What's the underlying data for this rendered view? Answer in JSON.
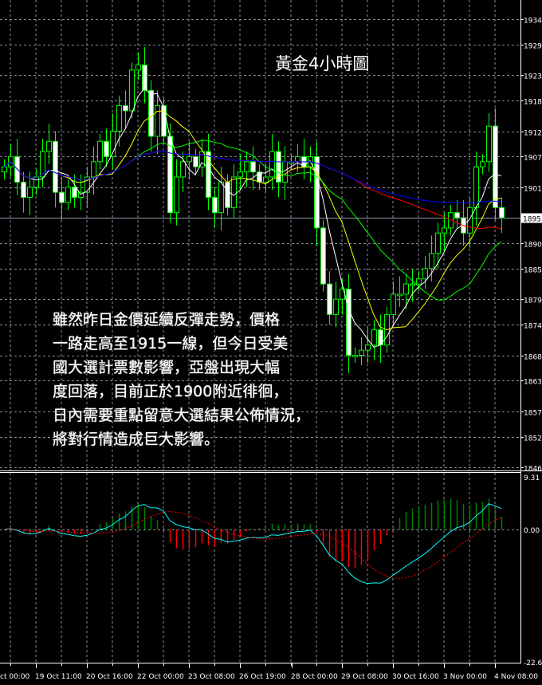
{
  "chart_data": {
    "type": "candlestick",
    "title": "黃金4小時圖",
    "price_axis": {
      "ticks": [
        1934,
        1929,
        1923,
        1918,
        1912,
        1907,
        1901,
        1895,
        1890,
        1885,
        1879,
        1874,
        1868,
        1863,
        1857,
        1852,
        1846
      ],
      "range": [
        1846,
        1934
      ],
      "current_price": 1895,
      "current_label": "1895"
    },
    "time_axis": {
      "ticks": [
        "ct 00:00",
        "19 Oct 11:00",
        "20 Oct 16:00",
        "22 Oct 00:00",
        "23 Oct 08:00",
        "26 Oct 19:00",
        "28 Oct 00:00",
        "29 Oct 08:00",
        "30 Oct 16:00",
        "3 Nov 00:00",
        "4 Nov 08:00"
      ]
    },
    "closes": [
      1905,
      1907,
      1902,
      1899,
      1901,
      1903,
      1908,
      1910,
      1900,
      1898,
      1901,
      1899,
      1900,
      1903,
      1906,
      1910,
      1907,
      1912,
      1917,
      1916,
      1924,
      1925,
      1920,
      1911,
      1917,
      1911,
      1896,
      1903,
      1906,
      1907,
      1905,
      1908,
      1899,
      1896,
      1902,
      1897,
      1903,
      1904,
      1906,
      1904,
      1902,
      1903,
      1908,
      1902,
      1906,
      1906,
      1907,
      1905,
      1907,
      1893,
      1882,
      1876,
      1879,
      1881,
      1868,
      1868,
      1869,
      1870,
      1873,
      1870,
      1876,
      1880,
      1880,
      1882,
      1882,
      1883,
      1885,
      1888,
      1892,
      1893,
      1896,
      1895,
      1892,
      1897,
      1905,
      1906,
      1913,
      1897,
      1895
    ],
    "moving_averages": [
      {
        "period": 5,
        "color": "#ffffff"
      },
      {
        "period": 10,
        "color": "#ffff00"
      },
      {
        "period": 20,
        "color": "#00ff00"
      },
      {
        "period": 50,
        "color": "#ff0000"
      },
      {
        "period": 100,
        "color": "#0000ff"
      }
    ],
    "macd": {
      "axis_labels": [
        "9.31",
        "0.00",
        "-22.6"
      ],
      "range": [
        -22.6,
        9.31
      ],
      "main_color": "#00ffff",
      "signal_color": "#ff0000",
      "hist_up": "#008000",
      "hist_down": "#ff0000"
    },
    "colors": {
      "bull_body": "#000000",
      "bear_body": "#ffffff",
      "outline": "#00ff00",
      "grid": "#8a8a9a"
    }
  },
  "annotation": {
    "lines": [
      "雖然昨日金價延續反彈走勢，價格",
      "一路走高至1915一線，但今日受美",
      "國大選計票數影響，亞盤出現大幅",
      "度回落，目前正於1900附近徘徊，",
      "日內需要重點留意大選結果公佈情況，",
      "將對行情造成巨大影響。"
    ]
  }
}
